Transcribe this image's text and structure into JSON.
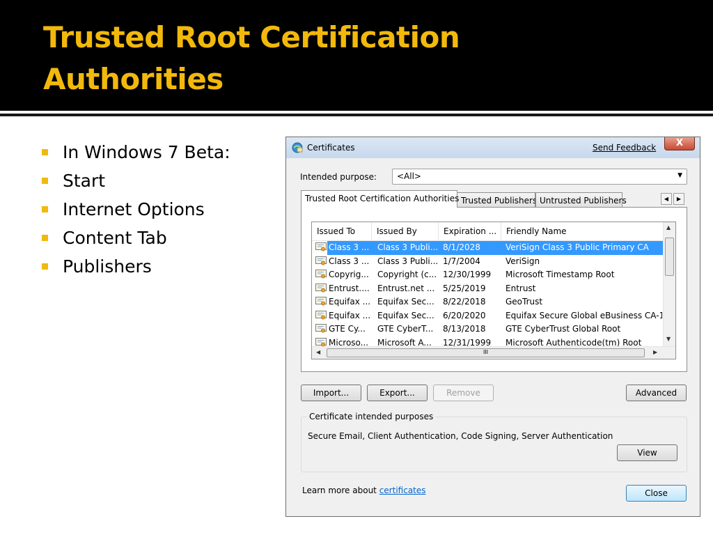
{
  "slide": {
    "title": "Trusted Root Certification\nAuthorities",
    "bullets": [
      "In Windows 7 Beta:",
      "Start",
      "Internet Options",
      "Content Tab",
      "Publishers"
    ]
  },
  "colors": {
    "title": "#f2b90c",
    "bullet": "#f2b90c",
    "selection": "#3399ff",
    "link": "#0066cc"
  },
  "dialog": {
    "title": "Certificates",
    "send_feedback": "Send Feedback",
    "close_glyph": "X",
    "intended_purpose_label": "Intended purpose:",
    "intended_purpose_value": "<All>",
    "tabs": [
      "Trusted Root Certification Authorities",
      "Trusted Publishers",
      "Untrusted Publishers"
    ],
    "columns": [
      "Issued To",
      "Issued By",
      "Expiration ...",
      "Friendly Name"
    ],
    "rows": [
      {
        "issued_to": "Class 3 ...",
        "issued_by": "Class 3 Publi...",
        "expiration": "8/1/2028",
        "friendly": "VeriSign Class 3 Public Primary CA",
        "selected": true
      },
      {
        "issued_to": "Class 3 ...",
        "issued_by": "Class 3 Publi...",
        "expiration": "1/7/2004",
        "friendly": "VeriSign"
      },
      {
        "issued_to": "Copyrig...",
        "issued_by": "Copyright (c...",
        "expiration": "12/30/1999",
        "friendly": "Microsoft Timestamp Root"
      },
      {
        "issued_to": "Entrust....",
        "issued_by": "Entrust.net ...",
        "expiration": "5/25/2019",
        "friendly": "Entrust"
      },
      {
        "issued_to": "Equifax ...",
        "issued_by": "Equifax Sec...",
        "expiration": "8/22/2018",
        "friendly": "GeoTrust"
      },
      {
        "issued_to": "Equifax ...",
        "issued_by": "Equifax Sec...",
        "expiration": "6/20/2020",
        "friendly": "Equifax Secure Global eBusiness CA-1"
      },
      {
        "issued_to": "GTE Cy...",
        "issued_by": "GTE CyberT...",
        "expiration": "8/13/2018",
        "friendly": "GTE CyberTrust Global Root"
      },
      {
        "issued_to": "Microso...",
        "issued_by": "Microsoft A...",
        "expiration": "12/31/1999",
        "friendly": "Microsoft Authenticode(tm) Root"
      }
    ],
    "buttons": {
      "import": "Import...",
      "export": "Export...",
      "remove": "Remove",
      "advanced": "Advanced",
      "view": "View",
      "close": "Close"
    },
    "purposes_group_title": "Certificate intended purposes",
    "purposes_text": "Secure Email, Client Authentication, Code Signing, Server Authentication",
    "learn_more_prefix": "Learn more about",
    "learn_more_link": "certificates",
    "hscroll_grip": "III"
  },
  "icons": [
    "certificates-app-icon",
    "certificate-icon",
    "scroll-arrows",
    "dropdown-arrow"
  ]
}
